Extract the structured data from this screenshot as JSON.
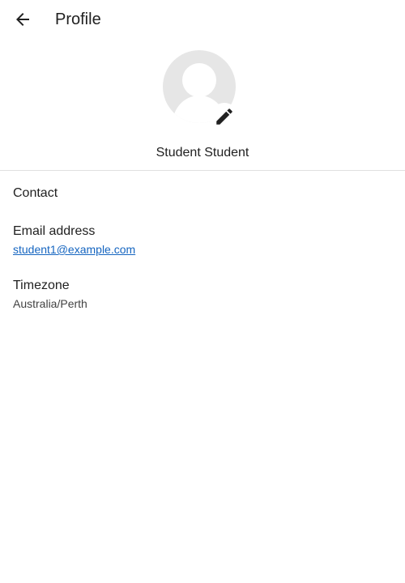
{
  "header": {
    "back_icon": "arrow-left-icon",
    "title": "Profile"
  },
  "profile": {
    "avatar_icon": "user-avatar-icon",
    "edit_icon": "pencil-icon",
    "name": "Student Student"
  },
  "contact": {
    "heading": "Contact",
    "email_label": "Email address",
    "email_value": "student1@example.com",
    "timezone_label": "Timezone",
    "timezone_value": "Australia/Perth"
  },
  "colors": {
    "link": "#1565c0",
    "divider": "#e0e0e0",
    "avatar_bg": "#e6e6e6"
  }
}
